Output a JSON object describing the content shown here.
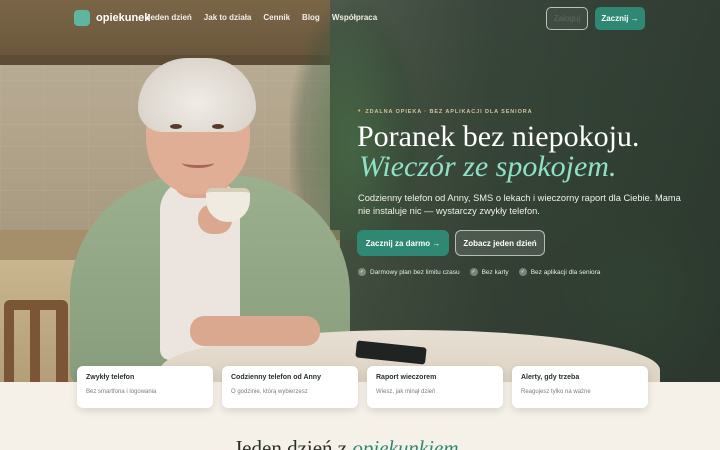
{
  "nav": {
    "logo_text": "opiekunek",
    "links": [
      "Jeden dzień",
      "Jak to działa",
      "Cennik",
      "Blog",
      "Współpraca"
    ],
    "login_label": "Zaloguj",
    "cta_label": "Zacznij →"
  },
  "hero": {
    "eyebrow": "ZDALNA OPIEKA · BEZ APLIKACJI DLA SENIORA",
    "headline": "Poranek bez niepokoju.",
    "headline_accent": "Wieczór ze spokojem.",
    "lead": "Codzienny telefon od Anny, SMS o lekach i wieczorny raport dla Ciebie. Mama nie instaluje nic — wystarczy zwykły telefon.",
    "primary_button": "Zacznij za darmo →",
    "secondary_button": "Zobacz jeden dzień",
    "checks": [
      "Darmowy plan bez limitu czasu",
      "Bez karty",
      "Bez aplikacji dla seniora"
    ]
  },
  "features": [
    {
      "title": "Zwykły telefon",
      "subtitle": "Bez smartfona i logowania"
    },
    {
      "title": "Codzienny telefon od Anny",
      "subtitle": "O godzinie, którą wybierzesz"
    },
    {
      "title": "Raport wieczorem",
      "subtitle": "Wiesz, jak minął dzień"
    },
    {
      "title": "Alerty, gdy trzeba",
      "subtitle": "Reagujesz tylko na ważne"
    }
  ],
  "section": {
    "heading_prefix": "Jeden dzień z",
    "heading_accent": "opiekunkiem"
  },
  "colors": {
    "accent": "#2e8873",
    "accent_light": "#8ee0c7",
    "background": "#f6f1e8"
  }
}
